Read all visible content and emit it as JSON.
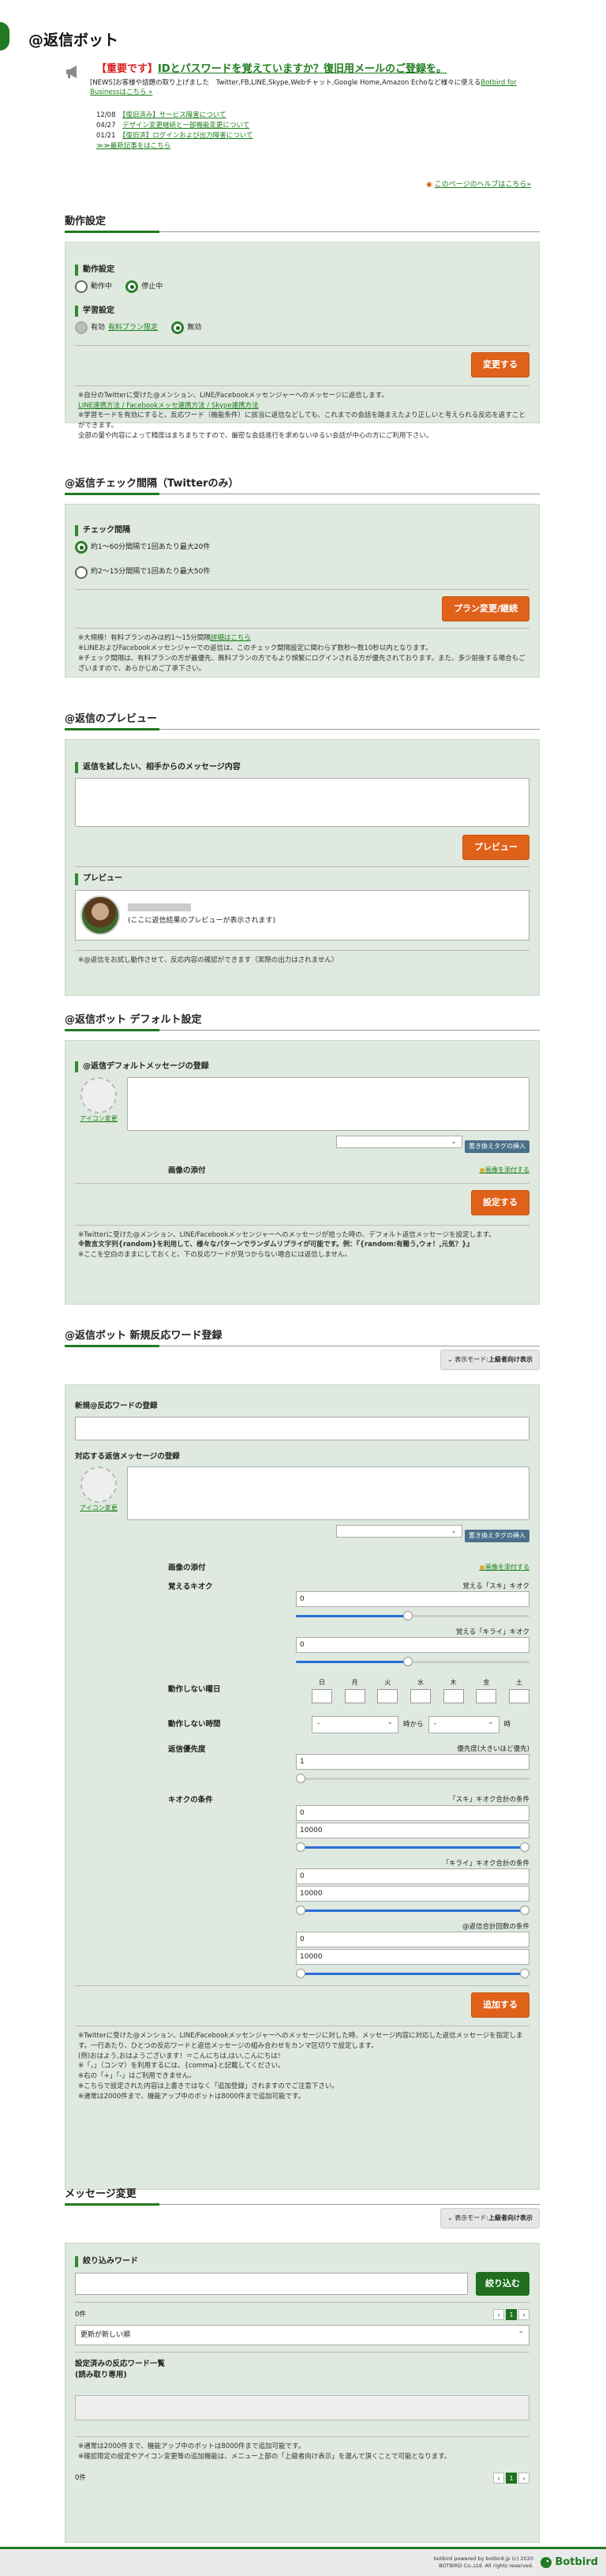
{
  "page": {
    "title": "@返信ボット"
  },
  "notice": {
    "headline_tag": "【重要です】",
    "headline": "IDとパスワードを覚えていますか？復旧用メールのご登録を。",
    "line1": "[NEWS]お客様や話題の取り上げました　Twitter,FB,LINE,Skype,Webチャット,Google Home,Amazon Echoなど様々に使える",
    "line1_link": "Botbird for Businessはこちら »",
    "items": [
      {
        "date": "12/08",
        "link": "【復旧済み】サービス障害について"
      },
      {
        "date": "04/27",
        "link": "デザイン変更継続と一部機能変更について"
      },
      {
        "date": "01/21",
        "link": "【復旧済】ログインおよび出力障害について"
      }
    ],
    "more": "≫≫最新記事をはこちら",
    "help": "このページのヘルプはこちら»"
  },
  "s1": {
    "title": "動作設定",
    "label1": "動作設定",
    "r_on": "動作中",
    "r_off": "停止中",
    "label2": "学習設定",
    "r_paid_pre": "有効",
    "r_paid_link": "有料プラン限定",
    "r_none": "無効",
    "button": "変更する",
    "notes": [
      "※自分のTwitterに受けた@メンション、LINE/Facebookメッセンジャーへのメッセージに返信します。",
      "LINE連携方法 / Facebookメッセ連携方法 / Skype連携方法",
      "※学習モードを有効にすると、反応ワード（機能条件）に該当に返信などしても、これまでの会話を踏まえたより正しいと考えられる反応を返すことができます。",
      "全部の量や内容によって精度はまちまちですので、厳密な会話進行を求めないゆるい会話が中心の方にご利用下さい。"
    ]
  },
  "s2": {
    "title": "@返信チェック間隔（Twitterのみ）",
    "label": "チェック間隔",
    "opt1": "約1〜60分間隔で1回あたり最大20件",
    "opt2": "約2〜15分間隔で1回あたり最大50件",
    "button": "プラン変更/継続",
    "notes": [
      "※大規模！有料プランのみは約1〜15分間隔",
      "詳細はこちら",
      "※LINEおよびFacebookメッセンジャーでの返信は、このチェック間隔設定に関わらず数秒〜数10秒以内となります。",
      "※チェック間隔は、有料プランの方が最優先、無料プランの方でもより頻繁にログインされる方が優先されております。また、多少前後する場合もございますので、あらかじめご了承下さい。"
    ]
  },
  "s3": {
    "title": "@返信のプレビュー",
    "label": "返信を試したい、相手からのメッセージ内容",
    "button": "プレビュー",
    "preview_label": "プレビュー",
    "preview_text": "(ここに返信結果のプレビューが表示されます)",
    "note": "※@返信をお試し動作させて、反応内容の確認ができます（実際の出力はされません）"
  },
  "s4": {
    "title": "@返信ボット デフォルト設定",
    "label": "@返信デフォルトメッセージの登録",
    "icon_change": "アイコン変更",
    "tag_btn": "置き換えタグの挿入",
    "image_label": "画像の添付",
    "image_link": "画像を添付する",
    "button": "設定する",
    "notes": [
      "※Twitterに受けた@メンション、LINE/Facebookメッセンジャーへのメッセージが拾った時の、デフォルト返信メッセージを設定します。",
      "※数言文字列{random}を利用して、様々なパターンでランダムリプライが可能です。例：『{random:有難う,ウォ！,元気？}』",
      "※ここを空白のままにしておくと、下の反応ワードが見つからない場合には返信しません。"
    ]
  },
  "s5": {
    "title": "@返信ボット 新規反応ワード登録",
    "mode_prefix": "表示モード:",
    "mode_value": "上級者向け表示",
    "word_label": "新規@反応ワードの登録",
    "msg_label": "対応する返信メッセージの登録",
    "icon_change": "アイコン変更",
    "tag_btn": "置き換えタグの挿入",
    "image_label": "画像の添付",
    "image_link": "画像を添付する",
    "likes_label": "覚えるキオク",
    "likes_text": "覚える「スキ」キオク",
    "likes_val": "0",
    "dislikes_text": "覚える「キライ」キオク",
    "dislikes_val": "0",
    "days_label": "動作しない曜日",
    "days": [
      "日",
      "月",
      "火",
      "水",
      "木",
      "金",
      "土"
    ],
    "hours_label": "動作しない時間",
    "hours_from": "-",
    "hours_mid": "時から",
    "hours_to": "-",
    "hours_end": "時",
    "prio_label": "返信優先度",
    "prio_text": "優先度(大きいほど優先)",
    "prio_val": "1",
    "cond_label": "キオクの条件",
    "cond1": "「スキ」キオク合計の条件",
    "cond1_min": "0",
    "cond1_max": "10000",
    "cond2": "「キライ」キオク合計の条件",
    "cond2_min": "0",
    "cond2_max": "10000",
    "cond3": "@返信合計回数の条件",
    "cond3_min": "0",
    "cond3_max": "10000",
    "button": "追加する",
    "notes": [
      "※Twitterに受けた@メンション、LINE/Facebookメッセンジャーへのメッセージに対した時、メッセージ内容に対応した返信メッセージを指定します。一行あたり、ひとつの反応ワードと返信メッセージの組み合わせをカンマ区切りで設定します。",
      "(例)おはよう,おはようございます！＝こんにちは,はい,こんにちは！",
      "※「，」（コンマ）を利用するには、{comma}と記載してください。",
      "※右の「+」「-」はご利用できません。",
      "※こちらで設定された内容は上書きではなく「追加登録」されますのでご注意下さい。",
      "※通常は2000件まで、機能アップ中のボットは8000件まで追加可能です。"
    ]
  },
  "s6": {
    "title": "メッセージ変更",
    "mode_prefix": "表示モード:",
    "mode_value": "上級者向け表示",
    "label": "絞り込みワード",
    "button": "絞り込む",
    "count": "0件",
    "sort": "更新が新しい順",
    "list_label": "設定済みの反応ワード一覧",
    "list_sub": "(読み取り専用)",
    "notes": [
      "※通常は2000件まで、機能アップ中のボットは8000件まで追加可能です。",
      "※確認限定の設定やアイコン変更等の追加機能は、メニュー上部の「上級者向け表示」を選んで頂くことで可能となります。"
    ],
    "count2": "0件"
  },
  "pager": {
    "prev": "‹",
    "cur": "1",
    "next": "›"
  },
  "footer": {
    "line1": "botbird powered by botbird.jp (c) 2020",
    "line2": "BOTBIRD Co.,Ltd. All rights reserved.",
    "logo": "Botbird"
  },
  "colors": {
    "brand": "#217a21",
    "accent": "#e0611a",
    "panel": "#dfe9df"
  }
}
